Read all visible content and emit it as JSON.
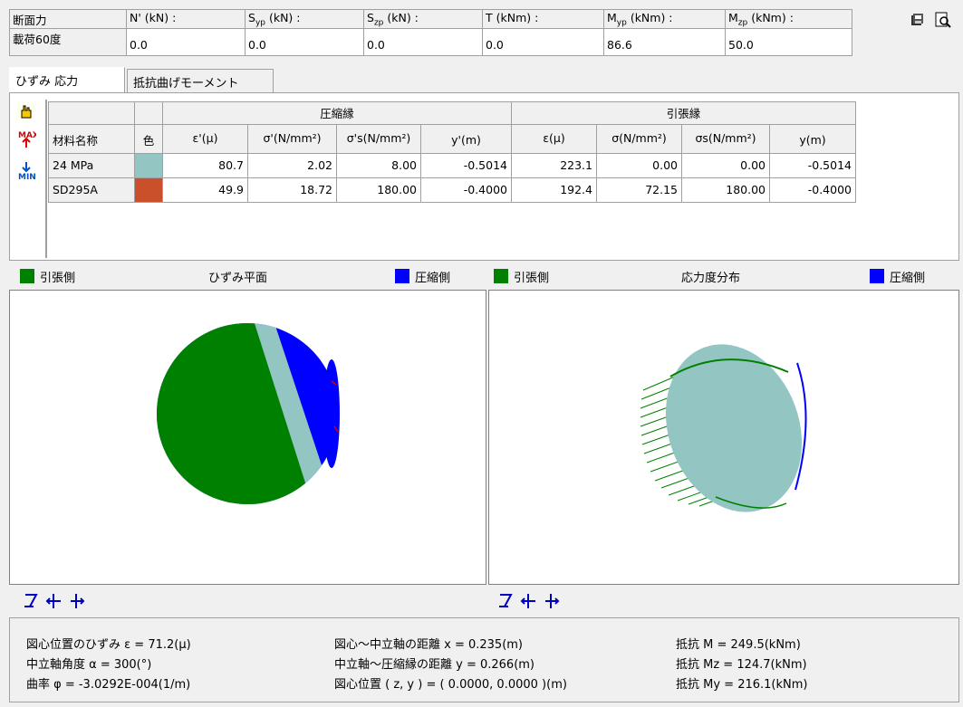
{
  "header": {
    "row1": [
      "断面力",
      "N' (kN) :",
      "S",
      "(kN) :",
      "S",
      "(kN) :",
      "T (kNm) :",
      "M",
      "(kNm) :",
      "M",
      "(kNm) :"
    ],
    "label1": "断面力",
    "label2": "載荷60度",
    "cols": [
      {
        "main": "N' (kN) :",
        "sub": ""
      },
      {
        "main": "S",
        "sub": "yp",
        "unit": " (kN) :"
      },
      {
        "main": "S",
        "sub": "zp",
        "unit": " (kN) :"
      },
      {
        "main": "T (kNm) :",
        "sub": ""
      },
      {
        "main": "M",
        "sub": "yp",
        "unit": " (kNm) :"
      },
      {
        "main": "M",
        "sub": "zp",
        "unit": " (kNm) :"
      }
    ],
    "values": [
      "0.0",
      "0.0",
      "0.0",
      "0.0",
      "86.6",
      "50.0"
    ]
  },
  "tabs": [
    "ひずみ 応力",
    "抵抗曲げモーメント"
  ],
  "table": {
    "group_compress": "圧縮縁",
    "group_tension": "引張縁",
    "col_name": "材料名称",
    "col_color": "色",
    "col_eps_c": "ε'(μ)",
    "col_sig_c": "σ'(N/mm²)",
    "col_sigs_c": "σ's(N/mm²)",
    "col_y_c": "y'(m)",
    "col_eps_t": "ε(μ)",
    "col_sig_t": "σ(N/mm²)",
    "col_sigs_t": "σs(N/mm²)",
    "col_y_t": "y(m)",
    "rows": [
      {
        "name": "24 MPa",
        "color": "#93c6c3",
        "v": [
          "80.7",
          "2.02",
          "8.00",
          "-0.5014",
          "223.1",
          "0.00",
          "0.00",
          "-0.5014"
        ]
      },
      {
        "name": "SD295A",
        "color": "#c9502a",
        "v": [
          "49.9",
          "18.72",
          "180.00",
          "-0.4000",
          "192.4",
          "72.15",
          "180.00",
          "-0.4000"
        ]
      }
    ]
  },
  "left_panel": {
    "title": "ひずみ平面",
    "legend_left": "引張側",
    "legend_right": "圧縮側"
  },
  "right_panel": {
    "title": "応力度分布",
    "legend_left": "引張側",
    "legend_right": "圧縮側"
  },
  "colors": {
    "tension": "#008000",
    "compression": "#0000ff",
    "concrete": "#93c6c3",
    "steel": "#c9502a"
  },
  "info": {
    "line1a": "図心位置のひずみ ε = 71.2(μ)",
    "line2a": "中立軸角度 α = 300(°)",
    "line3a": "曲率 φ = -3.0292E-004(1/m)",
    "line1b": "図心～中立軸の距離 x = 0.235(m)",
    "line2b": "中立軸～圧縮縁の距離 y = 0.266(m)",
    "line3b": "図心位置 ( z, y ) = ( 0.0000, 0.0000 )(m)",
    "line1c": "抵抗 M = 249.5(kNm)",
    "line2c": "抵抗 Mz = 124.7(kNm)",
    "line3c": "抵抗 My = 216.1(kNm)"
  },
  "icons": [
    "save-icon",
    "preview-icon",
    "hand-icon",
    "max-icon",
    "min-icon",
    "rotate-icon",
    "move-left-icon",
    "move-right-icon"
  ]
}
